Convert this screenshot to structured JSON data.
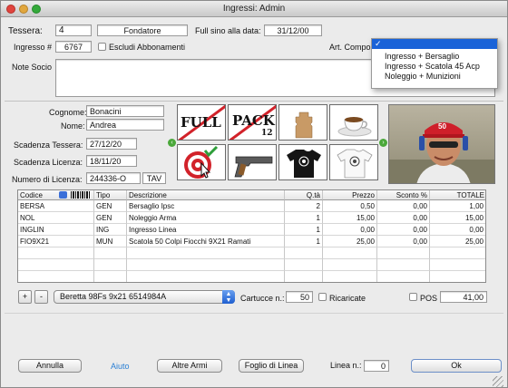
{
  "window": {
    "title": "Ingressi: Admin"
  },
  "header": {
    "tessera_label": "Tessera:",
    "tessera_value": "4",
    "tipo_socio": "Fondatore",
    "full_label": "Full sino alla data:",
    "full_value": "31/12/00",
    "ingresso_label": "Ingresso #",
    "ingresso_value": "6767",
    "escludi_label": "Escludi Abbonamenti",
    "art_label": "Art. Compos",
    "note_label": "Note Socio",
    "note_value": ""
  },
  "dropdown": {
    "selected": "",
    "options": [
      "Ingresso + Bersaglio",
      "Ingresso + Scatola 45 Acp",
      "Noleggio + Munizioni"
    ]
  },
  "socio": {
    "cognome_label": "Cognome:",
    "cognome_value": "Bonacini",
    "nome_label": "Nome:",
    "nome_value": "Andrea",
    "scad_tessera_label": "Scadenza Tessera:",
    "scad_tessera_value": "27/12/20",
    "scad_licenza_label": "Scadenza Licenza:",
    "scad_licenza_value": "18/11/20",
    "num_licenza_label": "Numero di Licenza:",
    "num_licenza_value": "244336-O",
    "licenza_tipo": "TAV"
  },
  "tiles": {
    "full_text": "FULL",
    "pack_text": "PACK",
    "pack_num": "12"
  },
  "table": {
    "headers": {
      "codice": "Codice",
      "tipo": "Tipo",
      "descrizione": "Descrizione",
      "qta": "Q.tà",
      "prezzo": "Prezzo",
      "sconto": "Sconto %",
      "totale": "TOTALE"
    },
    "rows": [
      {
        "codice": "BERSA",
        "tipo": "GEN",
        "descrizione": "Bersaglio Ipsc",
        "qta": "2",
        "prezzo": "0,50",
        "sconto": "0,00",
        "totale": "1,00"
      },
      {
        "codice": "NOL",
        "tipo": "GEN",
        "descrizione": "Noleggio Arma",
        "qta": "1",
        "prezzo": "15,00",
        "sconto": "0,00",
        "totale": "15,00"
      },
      {
        "codice": "INGLIN",
        "tipo": "ING",
        "descrizione": "Ingresso Linea",
        "qta": "1",
        "prezzo": "0,00",
        "sconto": "0,00",
        "totale": "0,00"
      },
      {
        "codice": "FIO9X21",
        "tipo": "MUN",
        "descrizione": "Scatola 50 Colpi Fiocchi 9X21 Ramati",
        "qta": "1",
        "prezzo": "25,00",
        "sconto": "0,00",
        "totale": "25,00"
      }
    ]
  },
  "bottom": {
    "add": "+",
    "remove": "-",
    "arma": "Beretta 98Fs 9x21 6514984A",
    "cartucce_label": "Cartucce n.:",
    "cartucce_value": "50",
    "ricaricate_label": "Ricaricate",
    "pos_label": "POS",
    "total": "41,00"
  },
  "footer": {
    "annulla": "Annulla",
    "aiuto": "Aiuto",
    "altre_armi": "Altre Armi",
    "foglio": "Foglio di Linea",
    "linea_label": "Linea n.:",
    "linea_value": "0",
    "ok": "Ok"
  },
  "colors": {
    "accent": "#1a63d8",
    "link": "#2a7fd4",
    "green": "#4aa83a",
    "red": "#d2222a"
  }
}
